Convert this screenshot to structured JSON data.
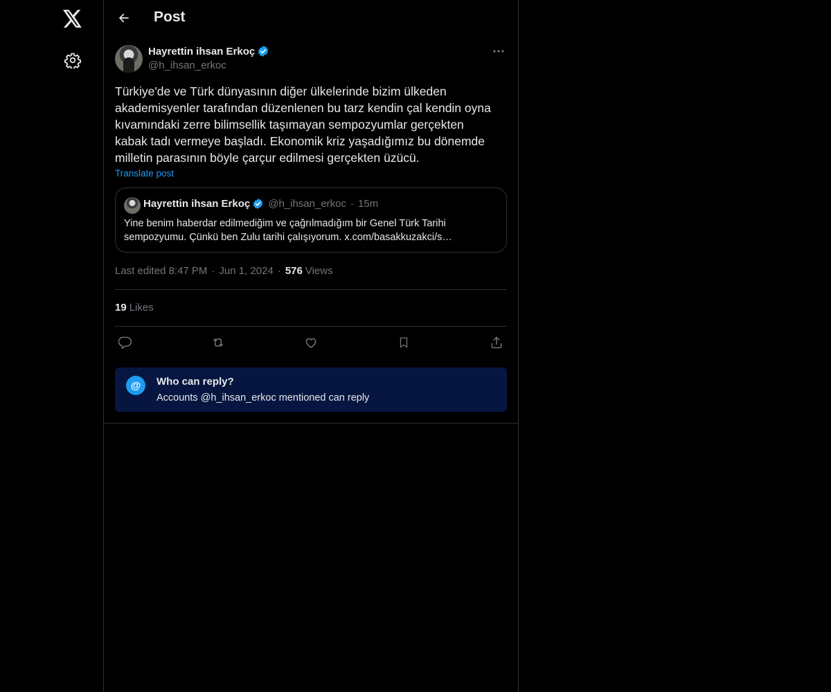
{
  "header": {
    "title": "Post"
  },
  "post": {
    "author_name": "Hayrettin ihsan Erkoç",
    "author_handle": "@h_ihsan_erkoc",
    "text": "Türkiye'de ve Türk dünyasının diğer ülkelerinde bizim ülkeden\nakademisyenler tarafından düzenlenen bu tarz kendin çal kendin oyna\nkıvamındaki zerre bilimsellik taşımayan sempozyumlar gerçekten\nkabak tadı vermeye başladı. Ekonomik kriz yaşadığımız bu dönemde\nmilletin parasının böyle çarçur edilmesi gerçekten üzücü.",
    "translate_label": "Translate post",
    "edited_label": "Last edited 8:47 PM",
    "date": "Jun 1, 2024",
    "views_count": "576",
    "views_label": "Views",
    "likes_count": "19",
    "likes_label": "Likes"
  },
  "quote": {
    "author_name": "Hayrettin ihsan Erkoç",
    "author_handle": "@h_ihsan_erkoc",
    "separator": "·",
    "time": "15m",
    "text": "Yine benim haberdar edilmediğim ve çağrılmadığım bir Genel Türk Tarihi sempozyumu. Çünkü ben Zulu tarihi çalışıyorum. x.com/basakkuzakci/s…"
  },
  "meta": {
    "separator": "·"
  },
  "reply_restriction": {
    "icon_glyph": "@",
    "title": "Who can reply?",
    "subtitle": "Accounts @h_ihsan_erkoc mentioned can reply"
  },
  "colors": {
    "background": "#000000",
    "accent": "#1d9bf0",
    "muted_text": "#71767b",
    "border": "#2f3336",
    "reply_box_bg": "#061640"
  },
  "icons": {
    "logo": "x-logo-icon",
    "settings": "gear-icon",
    "back": "arrow-left-icon",
    "more": "more-dots-icon",
    "verified": "verified-badge-icon",
    "reply": "reply-icon",
    "repost": "repost-icon",
    "like": "heart-icon",
    "bookmark": "bookmark-icon",
    "share": "share-icon"
  }
}
